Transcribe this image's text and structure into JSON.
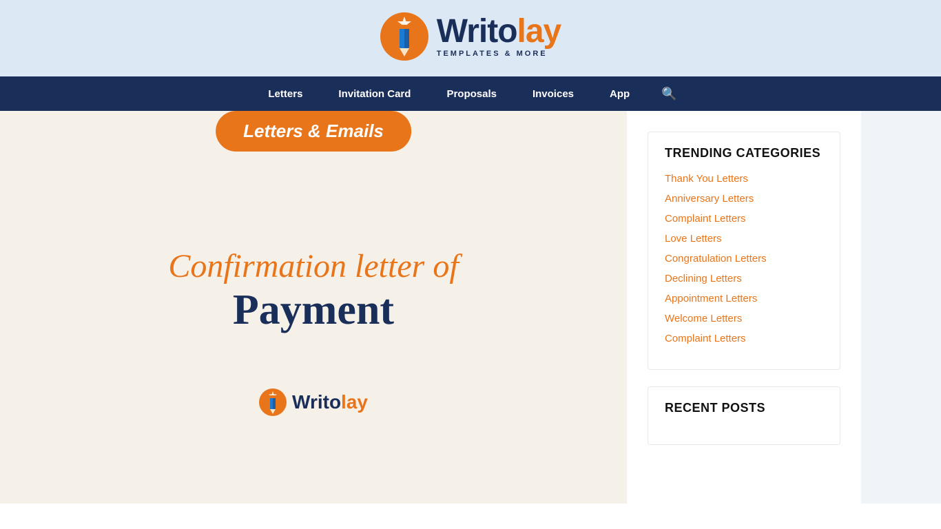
{
  "header": {
    "logo_write": "Writo",
    "logo_lay": "lay",
    "tagline": "TEMPLATES & MORE"
  },
  "nav": {
    "items": [
      {
        "label": "Letters",
        "href": "#"
      },
      {
        "label": "Invitation Card",
        "href": "#"
      },
      {
        "label": "Proposals",
        "href": "#"
      },
      {
        "label": "Invoices",
        "href": "#"
      },
      {
        "label": "App",
        "href": "#"
      }
    ]
  },
  "main": {
    "banner": "Letters & Emails",
    "hero_italic": "Confirmation letter of",
    "hero_bold": "Payment",
    "mini_logo_write": "Writo",
    "mini_logo_lay": "lay"
  },
  "sidebar": {
    "trending_title": "TRENDING CATEGORIES",
    "trending_links": [
      "Thank You Letters",
      "Anniversary Letters",
      "Complaint Letters",
      "Love Letters",
      "Congratulation Letters",
      "Declining Letters",
      "Appointment Letters",
      "Welcome Letters",
      "Complaint Letters"
    ],
    "recent_title": "RECENT POSTS"
  }
}
